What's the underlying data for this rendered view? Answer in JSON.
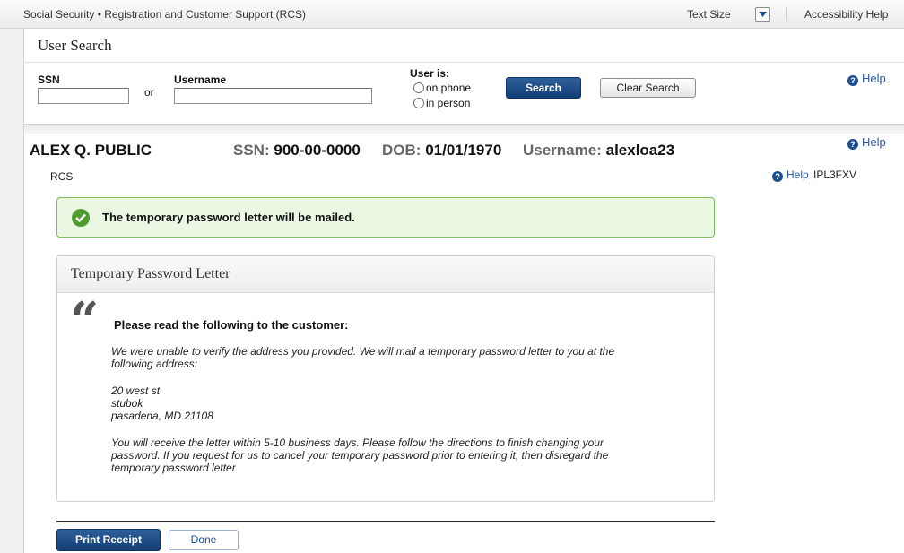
{
  "topbar": {
    "app_title": "Social Security • Registration and Customer Support (RCS)",
    "text_size_label": "Text Size",
    "accessibility_help": "Accessibility Help"
  },
  "panel": {
    "title": "User Search"
  },
  "search": {
    "ssn_label": "SSN",
    "ssn_value": "",
    "or_label": "or",
    "username_label": "Username",
    "username_value": "",
    "user_is_label": "User is:",
    "radio_phone": "on phone",
    "radio_person": "in person",
    "search_button": "Search",
    "clear_button": "Clear Search",
    "help": "Help"
  },
  "customer": {
    "name": "ALEX Q. PUBLIC",
    "ssn_label": "SSN:",
    "ssn_value": "900-00-0000",
    "dob_label": "DOB:",
    "dob_value": "01/01/1970",
    "username_label": "Username:",
    "username_value": "alexloa23",
    "help": "Help",
    "context": "RCS",
    "help2": "Help",
    "code": "IPL3FXV"
  },
  "alert": {
    "message": "The temporary password letter will be mailed."
  },
  "letter": {
    "title": "Temporary Password Letter",
    "instruction": "Please read the following to the customer:",
    "para1_line1": "We were unable to verify the address you provided. We will mail a temporary password letter to you at the",
    "para1_line2": "following address:",
    "address_line1": "20 west st",
    "address_line2": "stubok",
    "address_line3": "pasadena, MD 21108",
    "para2_line1": "You will receive the letter within 5-10 business days. Please follow the directions to finish changing your",
    "para2_line2": "password. If you request for us to cancel your temporary password prior to entering it, then disregard the",
    "para2_line3": "temporary password letter."
  },
  "actions": {
    "print_receipt": "Print Receipt",
    "done": "Done"
  },
  "colors": {
    "primary_button": "#1a467f",
    "success_border": "#7dbf52",
    "success_bg": "#eaf7e3",
    "help_icon": "#1c4f92"
  }
}
